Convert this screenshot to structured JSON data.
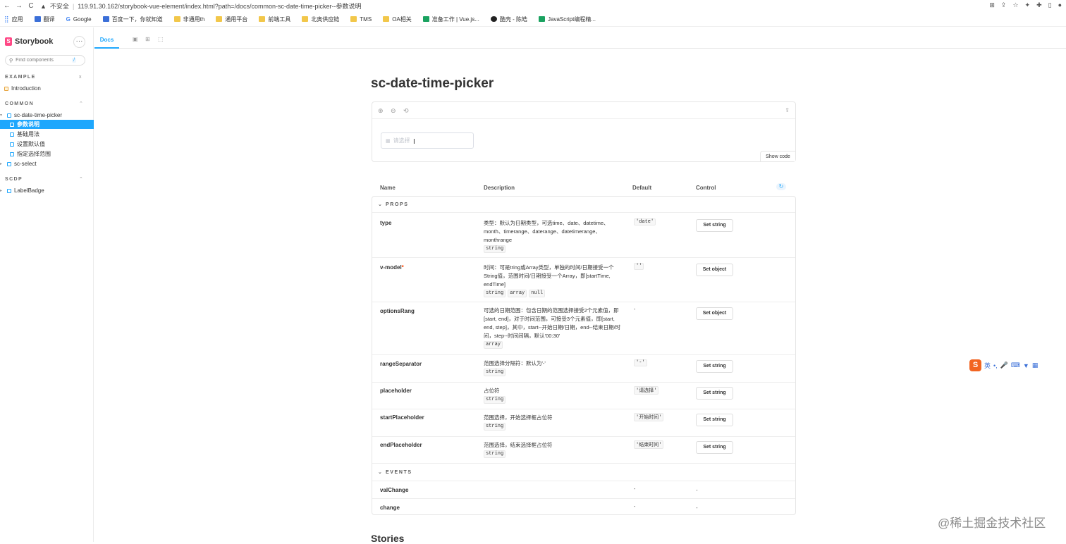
{
  "browser": {
    "back": "←",
    "forward": "→",
    "reload": "C",
    "security": "不安全",
    "url": "119.91.30.162/storybook-vue-element/index.html?path=/docs/common-sc-date-time-picker--参数说明"
  },
  "bookmarks": [
    "应用",
    "翻译",
    "Google",
    "百度一下，你就知道",
    "非通用th",
    "通用平台",
    "前端工具",
    "北奥供应链",
    "TMS",
    "OA相关",
    "准备工作 | Vue.js...",
    "酷壳 - 陈皓",
    "JavaScript编程精..."
  ],
  "sidebar": {
    "brand": "Storybook",
    "search_placeholder": "Find components",
    "search_shortcut": "/",
    "sections": [
      {
        "title": "EXAMPLE",
        "control": "x"
      },
      {
        "title": "COMMON",
        "control": "⌃"
      },
      {
        "title": "SCDP",
        "control": "⌃"
      }
    ],
    "items": [
      "Introduction",
      "sc-date-time-picker",
      "参数说明",
      "基础用法",
      "设置默认值",
      "指定选择范围",
      "sc-select",
      "LabelBadge"
    ]
  },
  "toolbar": {
    "docs_tab": "Docs"
  },
  "doc": {
    "title": "sc-date-time-picker",
    "picker_placeholder": "请选择",
    "show_code": "Show code",
    "stories_heading": "Stories"
  },
  "argtable": {
    "headers": [
      "Name",
      "Description",
      "Default",
      "Control"
    ],
    "groups": [
      "PROPS",
      "EVENTS"
    ],
    "rows": [
      {
        "name": "type",
        "required": "",
        "desc": "类型：默认为日期类型，可选time、date、datetime、month、timerange、daterange、datetimerange、monthrange",
        "types": [
          "string"
        ],
        "default": "'date'",
        "control": "Set string"
      },
      {
        "name": "v-model",
        "required": "*",
        "desc": "时间：可是tring或Array类型，单独的时间/日期接受一个String值，范围时间/日期接受一个Array，即[startTime, endTime]",
        "types": [
          "string",
          "array",
          "null"
        ],
        "default": "''",
        "control": "Set object"
      },
      {
        "name": "optionsRang",
        "required": "",
        "desc": "可选的日期范围：包含日期的范围选择接受2个元素值，即[start, end]，对于时间范围，可接受3个元素值，即[start, end, step]，其中，start--开始日期/日期，end--结束日期/时间，step--时间间隔，默认'00:30'",
        "types": [
          "array"
        ],
        "default": "-",
        "control": "Set object"
      },
      {
        "name": "rangeSeparator",
        "required": "",
        "desc": "范围选择分隔符：默认为'-'",
        "types": [
          "string"
        ],
        "default": "'-'",
        "control": "Set string"
      },
      {
        "name": "placeholder",
        "required": "",
        "desc": "占位符",
        "types": [
          "string"
        ],
        "default": "'请选择'",
        "control": "Set string"
      },
      {
        "name": "startPlaceholder",
        "required": "",
        "desc": "范围选择，开始选择框占位符",
        "types": [
          "string"
        ],
        "default": "'开始时间'",
        "control": "Set string"
      },
      {
        "name": "endPlaceholder",
        "required": "",
        "desc": "范围选择，结束选择框占位符",
        "types": [
          "string"
        ],
        "default": "'结束时间'",
        "control": "Set string"
      }
    ],
    "events": [
      {
        "name": "valChange",
        "default": "-",
        "control": "-"
      },
      {
        "name": "change",
        "default": "-",
        "control": "-"
      }
    ]
  },
  "ime": {
    "logo": "S",
    "mode": "英"
  },
  "watermark": "@稀土掘金技术社区"
}
